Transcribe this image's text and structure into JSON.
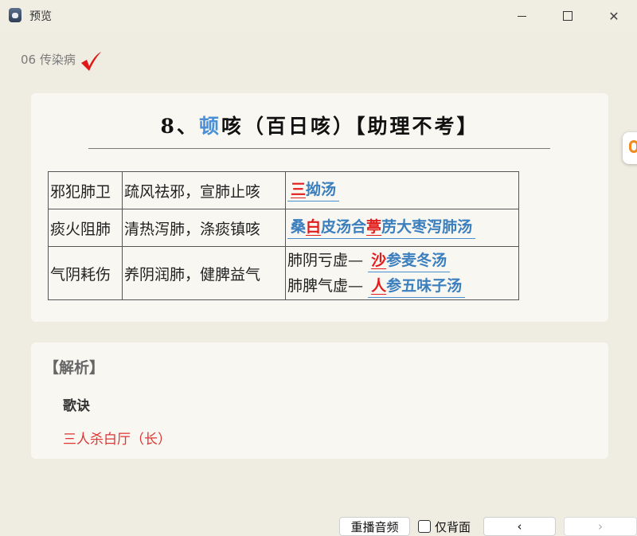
{
  "window": {
    "title": "预览",
    "controls": {
      "minimize": "minimize",
      "maximize": "maximize",
      "close": "✕"
    }
  },
  "deck": {
    "name": "06 传染病"
  },
  "card": {
    "heading_prefix": "8、",
    "heading_highlight": "顿",
    "heading_suffix": "咳（百日咳）【助理不考】",
    "rows": [
      {
        "pattern": "邪犯肺卫",
        "method": "疏风祛邪，宣肺止咳",
        "rx_red": "三",
        "rx_rest": "拗汤"
      },
      {
        "pattern": "痰火阻肺",
        "method": "清热泻肺，涤痰镇咳",
        "rx_a": "桑",
        "rx_b": "白",
        "rx_c": "皮汤合",
        "rx_d": "葶",
        "rx_e": "苈大枣泻肺汤"
      },
      {
        "pattern": "气阴耗伤",
        "method": "养阴润肺，健脾益气",
        "sub1_label": "肺阴亏虚—",
        "sub1_red": "沙",
        "sub1_rest": "参麦冬汤",
        "sub2_label": "肺脾气虚—",
        "sub2_red": "人",
        "sub2_rest": "参五味子汤"
      }
    ]
  },
  "analysis": {
    "title": "【解析】",
    "song_label": "歌诀",
    "song_text": "三人杀白厅（长）"
  },
  "toolbar": {
    "replay": "重播音频",
    "back_only": "仅背面",
    "prev": "‹",
    "next": "›"
  },
  "colors": {
    "accent_blue": "#3b7fbf",
    "accent_red": "#e21b1b",
    "highlight": "#4a90d9",
    "check": "#e01818"
  },
  "icons": {
    "check": "check-icon",
    "app": "app-icon",
    "side_tab": "scroll-tab-icon"
  }
}
